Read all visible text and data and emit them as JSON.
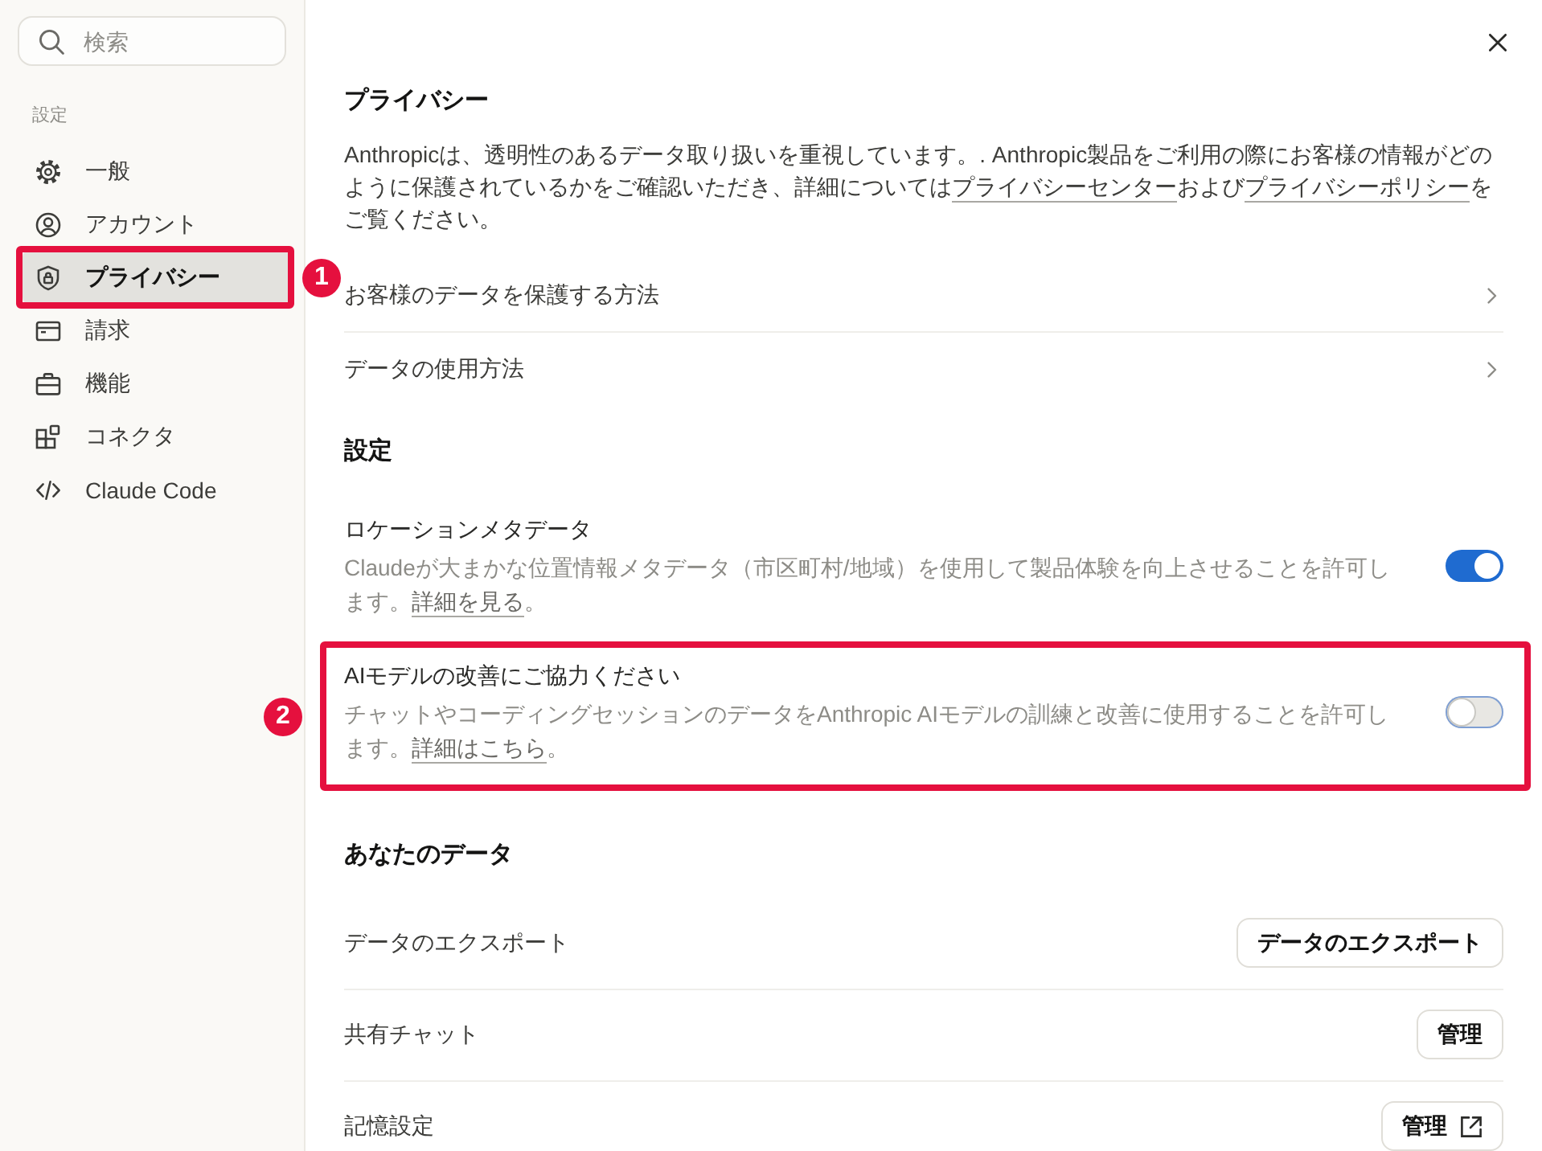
{
  "sidebar": {
    "search": {
      "placeholder": "検索"
    },
    "section_label": "設定",
    "items": [
      {
        "label": "一般",
        "selected": false
      },
      {
        "label": "アカウント",
        "selected": false
      },
      {
        "label": "プライバシー",
        "selected": true,
        "annotation": "1"
      },
      {
        "label": "請求",
        "selected": false
      },
      {
        "label": "機能",
        "selected": false
      },
      {
        "label": "コネクタ",
        "selected": false
      },
      {
        "label": "Claude Code",
        "selected": false
      }
    ]
  },
  "privacy": {
    "heading": "プライバシー",
    "intro": [
      {
        "kind": "text",
        "text": "Anthropicは、透明性のあるデータ取り扱いを重視しています。. Anthropic製品をご利用の際にお客様の情報がどのように保護されているかをご確認いただき、詳細については"
      },
      {
        "kind": "link",
        "text": "プライバシーセンター"
      },
      {
        "kind": "text",
        "text": "および"
      },
      {
        "kind": "link",
        "text": "プライバシーポリシー"
      },
      {
        "kind": "text",
        "text": "をご覧ください。"
      }
    ],
    "links": [
      {
        "label": "お客様のデータを保護する方法"
      },
      {
        "label": "データの使用方法"
      }
    ]
  },
  "settings": {
    "heading": "設定",
    "toggles": [
      {
        "title": "ロケーションメタデータ",
        "description": [
          {
            "kind": "text",
            "text": "Claudeが大まかな位置情報メタデータ（市区町村/地域）を使用して製品体験を向上させることを許可します。"
          },
          {
            "kind": "link",
            "text": "詳細を見る"
          },
          {
            "kind": "text",
            "text": "。"
          }
        ],
        "on": true
      },
      {
        "title": "AIモデルの改善にご協力ください",
        "description": [
          {
            "kind": "text",
            "text": "チャットやコーディングセッションのデータをAnthropic AIモデルの訓練と改善に使用することを許可します。"
          },
          {
            "kind": "link",
            "text": "詳細はこちら"
          },
          {
            "kind": "text",
            "text": "。"
          }
        ],
        "on": false,
        "annotation": "2"
      }
    ]
  },
  "your_data": {
    "heading": "あなたのデータ",
    "rows": [
      {
        "label": "データのエクスポート",
        "button": "データのエクスポート",
        "kind": "plain"
      },
      {
        "label": "共有チャット",
        "button": "管理",
        "kind": "plain"
      },
      {
        "label": "記憶設定",
        "button": "管理",
        "kind": "external"
      }
    ]
  }
}
